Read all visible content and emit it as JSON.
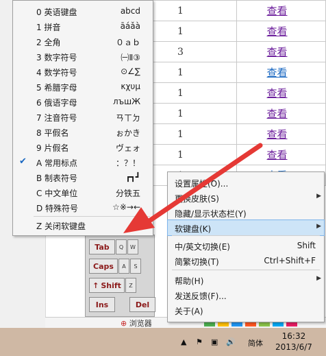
{
  "table": {
    "rows": [
      {
        "num": "1",
        "link": "查看"
      },
      {
        "num": "1",
        "link": "查看"
      },
      {
        "num": "3",
        "link": "查看"
      },
      {
        "num": "1",
        "link": "查看"
      },
      {
        "num": "1",
        "link": "查看"
      },
      {
        "num": "1",
        "link": "查看"
      },
      {
        "num": "1",
        "link": "查看"
      },
      {
        "num": "1",
        "link": "查看"
      },
      {
        "num": "1",
        "link": "查看"
      }
    ]
  },
  "symbol_menu": {
    "items": [
      {
        "label": "0 英语键盘",
        "sample": "abcd",
        "checked": false
      },
      {
        "label": "1 拼音",
        "sample": "āáǎà",
        "checked": false
      },
      {
        "label": "2 全角",
        "sample": "０ａｂ",
        "checked": false
      },
      {
        "label": "3 数字符号",
        "sample": "㈠Ⅱ③",
        "checked": false
      },
      {
        "label": "4 数学符号",
        "sample": "⊙∠∑",
        "checked": false
      },
      {
        "label": "5 希腊字母",
        "sample": "κχυμ",
        "checked": false
      },
      {
        "label": "6 俄语字母",
        "sample": "лъшЖ",
        "checked": false
      },
      {
        "label": "7 注音符号",
        "sample": "ㄢㄒㄉ",
        "checked": false
      },
      {
        "label": "8 平假名",
        "sample": "ぉかき",
        "checked": false
      },
      {
        "label": "9 片假名",
        "sample": "ヴェォ",
        "checked": false
      },
      {
        "label": "A 常用标点",
        "sample": "：？！",
        "checked": true
      },
      {
        "label": "B 制表符号",
        "sample": "┏┓┛",
        "checked": false
      },
      {
        "label": "C 中文单位",
        "sample": "分铁五",
        "checked": false
      },
      {
        "label": "D 特殊符号",
        "sample": "☆※→←",
        "checked": false
      }
    ],
    "close_label": "Z 关闭软键盘"
  },
  "context_menu": {
    "items": [
      {
        "label": "设置属性(O)...",
        "shortcut": "",
        "submenu": false,
        "highlight": false
      },
      {
        "label": "更换皮肤(S)",
        "shortcut": "",
        "submenu": true,
        "highlight": false
      },
      {
        "label": "隐藏/显示状态栏(Y)",
        "shortcut": "",
        "submenu": false,
        "highlight": false
      },
      {
        "label": "软键盘(K)",
        "shortcut": "",
        "submenu": true,
        "highlight": true
      },
      {
        "label": "中/英文切换(E)",
        "shortcut": "Shift",
        "submenu": false,
        "highlight": false
      },
      {
        "label": "简繁切换(T)",
        "shortcut": "Ctrl+Shift+F",
        "submenu": false,
        "highlight": false
      },
      {
        "label": "帮助(H)",
        "shortcut": "",
        "submenu": true,
        "highlight": false
      },
      {
        "label": "发送反馈(F)...",
        "shortcut": "",
        "submenu": false,
        "highlight": false
      },
      {
        "label": "关于(A)",
        "shortcut": "",
        "submenu": false,
        "highlight": false
      }
    ]
  },
  "keyboard": {
    "tab": "Tab",
    "caps": "Caps",
    "shift": "Shift",
    "ins": "Ins",
    "del": "Del"
  },
  "status": {
    "browse": "浏览器",
    "ime_lang": "简体",
    "time": "16:32",
    "date": "2013/6/7"
  },
  "colors": {
    "arrow": "#e53935",
    "highlight": "#cde4f7",
    "ime_squares": [
      "#4caf50",
      "#ffc107",
      "#2196f3",
      "#ff5722",
      "#8bc34a",
      "#03a9f4",
      "#e91e63"
    ]
  }
}
